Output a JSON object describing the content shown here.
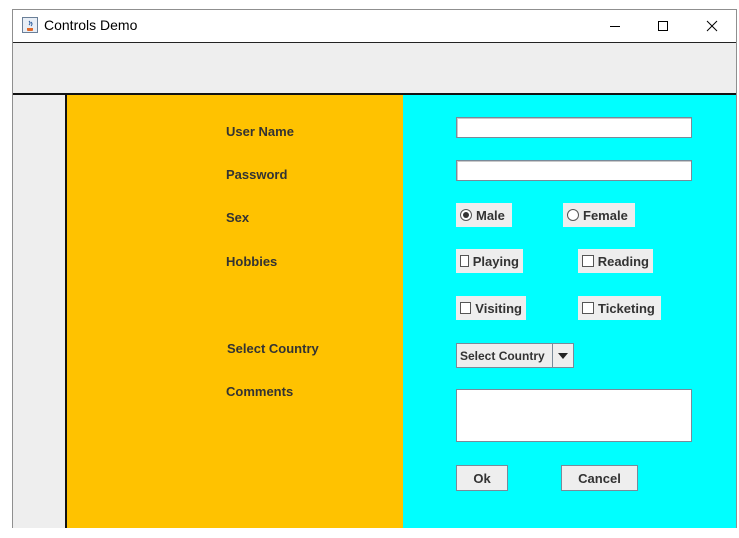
{
  "window": {
    "title": "Controls Demo",
    "icon": "java-cup-icon"
  },
  "titlebar_buttons": [
    "minimize-icon",
    "maximize-icon",
    "close-icon"
  ],
  "form": {
    "labels": {
      "username": "User Name",
      "password": "Password",
      "sex": "Sex",
      "hobbies": "Hobbies",
      "country": "Select Country",
      "comments": "Comments"
    },
    "username_value": "",
    "password_value": "",
    "sex_options": [
      {
        "label": "Male",
        "selected": true
      },
      {
        "label": "Female",
        "selected": false
      }
    ],
    "hobbies": [
      {
        "label": "Playing",
        "checked": false
      },
      {
        "label": "Reading",
        "checked": false
      },
      {
        "label": "Visiting",
        "checked": false
      },
      {
        "label": "Ticketing",
        "checked": false
      }
    ],
    "country_selected": "Select Country",
    "comments_value": "",
    "buttons": {
      "ok": "Ok",
      "cancel": "Cancel"
    }
  },
  "colors": {
    "left_panel": "#ffc200",
    "right_panel": "#00ffff",
    "control_bg": "#eeeeee",
    "label_text": "#333333"
  }
}
